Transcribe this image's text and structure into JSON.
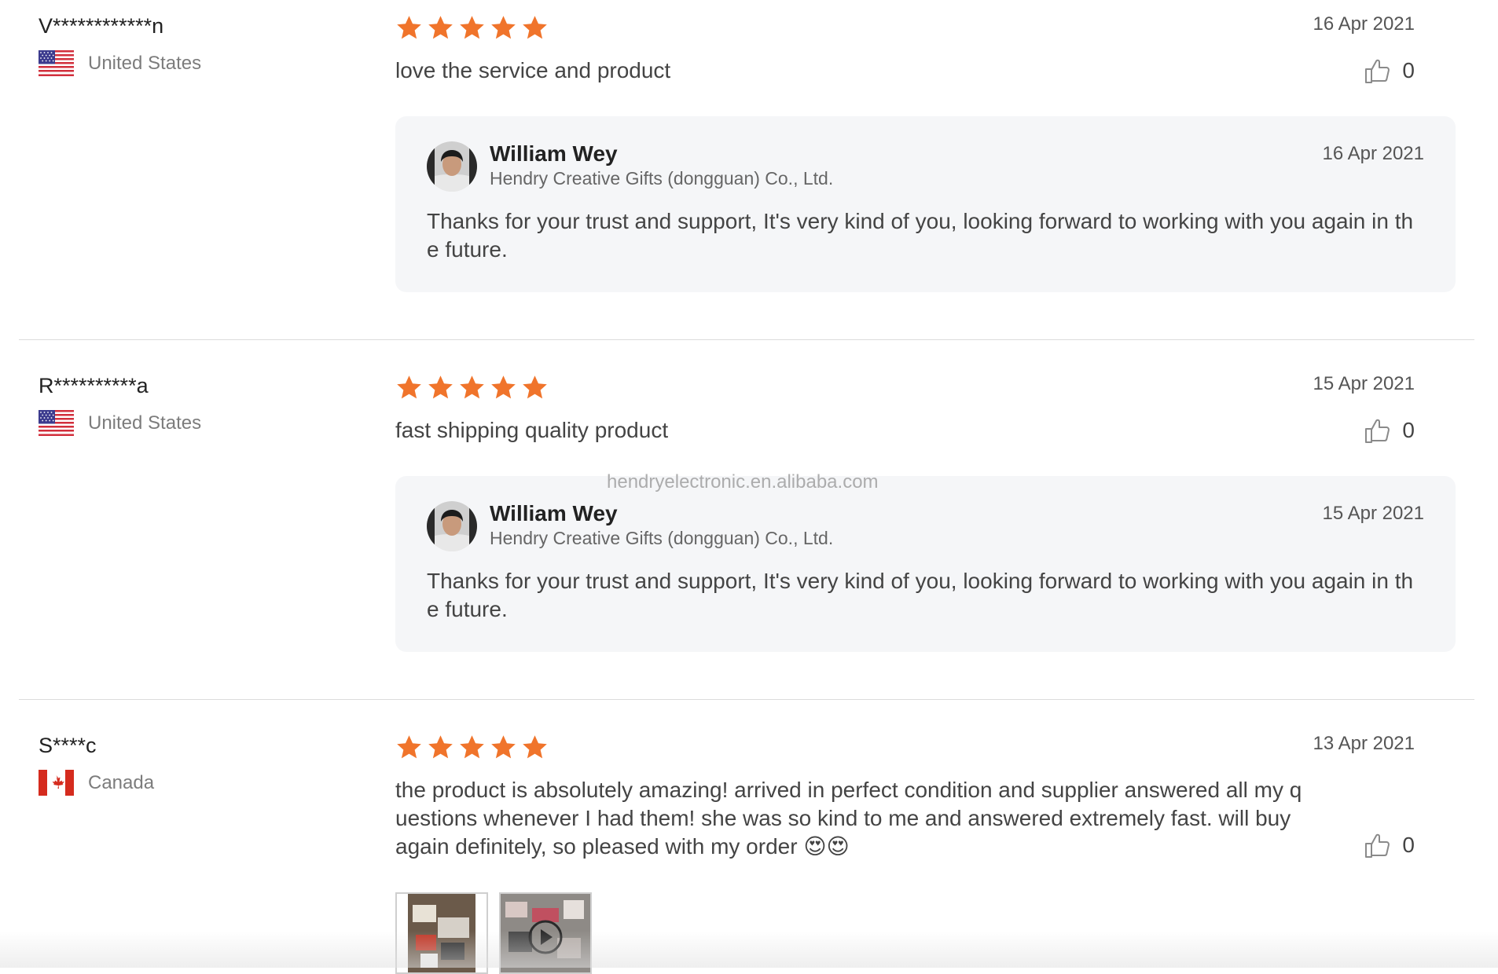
{
  "reviews": [
    {
      "reviewer": "V************n",
      "country": "United States",
      "flag": "us-flag-icon",
      "rating": 5,
      "date": "16 Apr 2021",
      "text": "love the service and product",
      "helpful_count": "0",
      "reply": {
        "name": "William Wey",
        "company": "Hendry Creative Gifts (dongguan) Co., Ltd.",
        "date": "16 Apr 2021",
        "text": "Thanks for your trust and support, It's very kind of you, looking forward to working with you again in the future."
      }
    },
    {
      "reviewer": "R**********a",
      "country": "United States",
      "flag": "us-flag-icon",
      "rating": 5,
      "date": "15 Apr 2021",
      "text": "fast shipping quality product",
      "helpful_count": "0",
      "reply": {
        "name": "William Wey",
        "company": "Hendry Creative Gifts (dongguan) Co., Ltd.",
        "date": "15 Apr 2021",
        "text": "Thanks for your trust and support, It's very kind of you, looking forward to working with you again in the future."
      }
    },
    {
      "reviewer": "S****c",
      "country": "Canada",
      "flag": "canada-flag-icon",
      "rating": 5,
      "date": "13 Apr 2021",
      "text": "the product is absolutely amazing! arrived in perfect condition and supplier answered all my questions whenever I had them! she was so kind to me and answered extremely fast. will buy again definitely, so pleased with my order 😍😍",
      "helpful_count": "0",
      "media": [
        "photo-thumbnail",
        "video-thumbnail"
      ]
    }
  ],
  "watermark": "hendryelectronic.en.alibaba.com",
  "colors": {
    "star": "#F0742B",
    "reply_bg": "#F5F6F8",
    "divider": "#DCDCDC"
  },
  "icons": {
    "helpful": "thumbs-up-icon",
    "star": "star-icon",
    "play": "play-icon"
  }
}
